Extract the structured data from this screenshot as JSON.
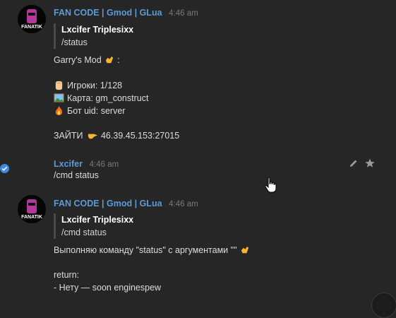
{
  "messages": [
    {
      "author": "FAN CODE | Gmod | GLua",
      "time": "4:46 am",
      "quote_author": "Lxcifer Triplesixx",
      "quote_text": "/status",
      "lines": {
        "title": "Garry's Mod",
        "players": "Игроки: 1/128",
        "map": "Карта: gm_construct",
        "bot": "Бот uid: server",
        "join": "ЗАЙТИ",
        "address": "46.39.45.153:27015"
      }
    },
    {
      "author": "Lxcifer",
      "time": "4:46 am",
      "text": "/cmd status"
    },
    {
      "author": "FAN CODE | Gmod | GLua",
      "time": "4:46 am",
      "quote_author": "Lxcifer Triplesixx",
      "quote_text": "/cmd status",
      "lines": {
        "executing": "Выполняю команду \"status\" с аргументами \"\"",
        "return": "return:",
        "result": "- Нету — soon enginespew"
      }
    }
  ],
  "avatar_label": "FANATIK",
  "icons": {
    "avatar": "fanatik-bot-avatar",
    "verified": "verified-check-icon",
    "edit": "pencil-icon",
    "star": "star-icon",
    "cursor": "hand-pointer-icon",
    "thumbs_up": "ok-hand-emoji",
    "fist": "raised-fist-emoji",
    "picture": "landscape-picture-emoji",
    "fire": "fire-emoji",
    "pointing": "pointing-right-emoji"
  },
  "colors": {
    "background": "#262626",
    "author": "#5c9bd6",
    "verified": "#3f8ae0"
  }
}
